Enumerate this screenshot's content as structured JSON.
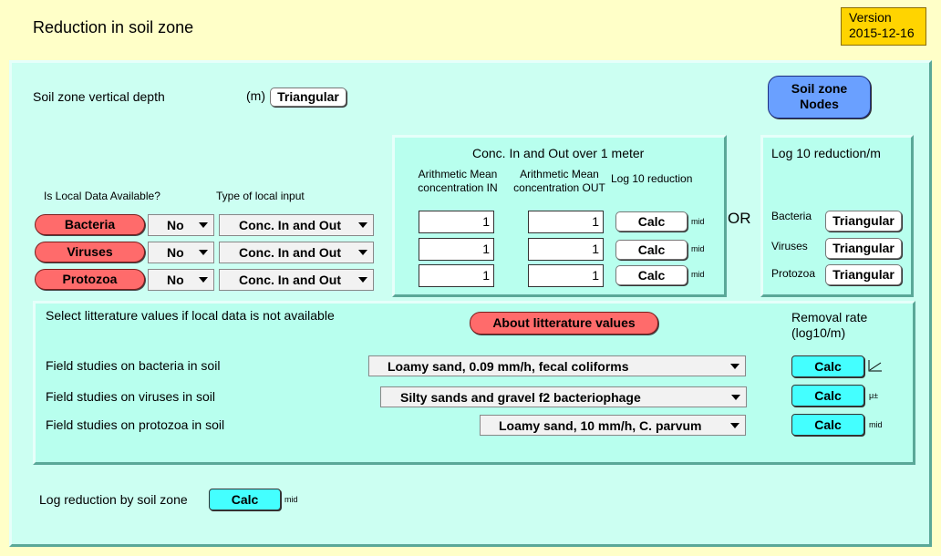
{
  "header": {
    "title": "Reduction in soil zone",
    "version_label": "Version",
    "version_date": "2015-12-16"
  },
  "depth": {
    "label": "Soil zone vertical depth",
    "unit": "(m)",
    "button": "Triangular"
  },
  "nodes_button": {
    "line1": "Soil zone",
    "line2": "Nodes"
  },
  "local": {
    "available_label": "Is Local Data Available?",
    "type_label": "Type of local input",
    "rows": [
      {
        "organism": "Bacteria",
        "available": "No",
        "type": "Conc. In and Out"
      },
      {
        "organism": "Viruses",
        "available": "No",
        "type": "Conc. In and Out"
      },
      {
        "organism": "Protozoa",
        "available": "No",
        "type": "Conc. In and Out"
      }
    ]
  },
  "conc_panel": {
    "title": "Conc. In and Out over 1 meter",
    "col_in": [
      "Arithmetic Mean",
      "concentration IN"
    ],
    "col_out": [
      "Arithmetic Mean",
      "concentration OUT"
    ],
    "col_log": "Log 10 reduction",
    "rows": [
      {
        "in": "1",
        "out": "1",
        "calc": "Calc",
        "tag": "mid"
      },
      {
        "in": "1",
        "out": "1",
        "calc": "Calc",
        "tag": "mid"
      },
      {
        "in": "1",
        "out": "1",
        "calc": "Calc",
        "tag": "mid"
      }
    ]
  },
  "or_label": "OR",
  "log_panel": {
    "title": "Log 10 reduction/m",
    "rows": [
      {
        "label": "Bacteria",
        "button": "Triangular"
      },
      {
        "label": "Viruses",
        "button": "Triangular"
      },
      {
        "label": "Protozoa",
        "button": "Triangular"
      }
    ]
  },
  "lit_panel": {
    "instruction": "Select litterature values if local data is not available",
    "about_button": "About litterature values",
    "rate_label_1": "Removal rate",
    "rate_label_2": "(log10/m)",
    "rows": [
      {
        "label": "Field studies on bacteria in soil",
        "value": "Loamy sand, 0.09 mm/h, fecal coliforms",
        "calc": "Calc",
        "icon": "trend-line-icon"
      },
      {
        "label": "Field studies on viruses in soil",
        "value": "Silty sands and gravel f2 bacteriophage",
        "calc": "Calc",
        "tag": "μ±"
      },
      {
        "label": "Field studies on protozoa in soil",
        "value": "Loamy sand, 10 mm/h, C. parvum",
        "calc": "Calc",
        "tag": "mid"
      }
    ]
  },
  "footer": {
    "label": "Log reduction by soil zone",
    "calc": "Calc",
    "tag": "mid"
  }
}
